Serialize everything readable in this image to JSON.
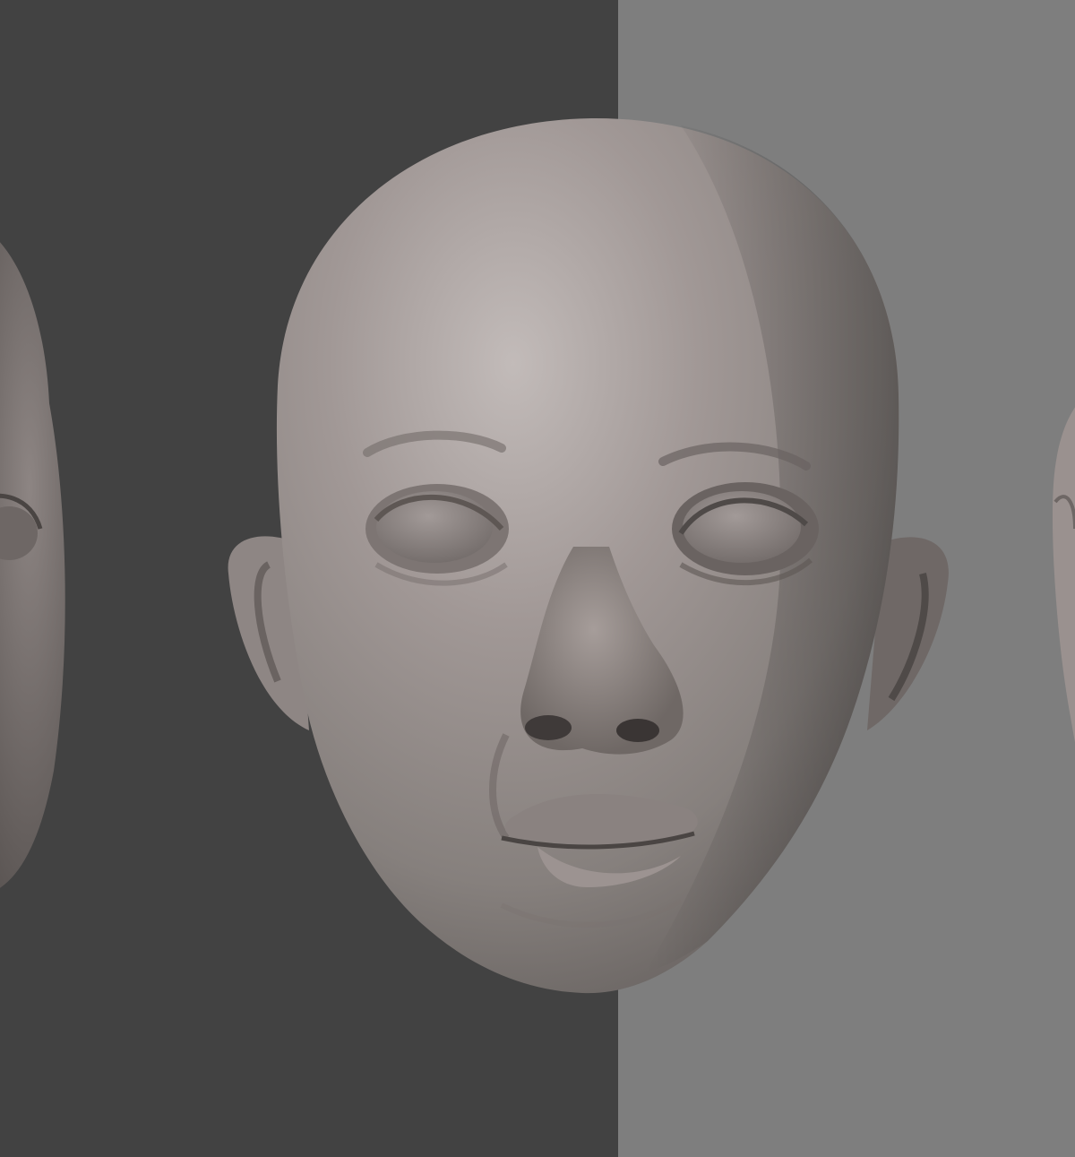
{
  "scene": {
    "subject": "sculpted-head-render",
    "colors": {
      "background_left": "#424242",
      "background_right": "#7e7e7e",
      "clay_light": "#bdb6b4",
      "clay_mid": "#8f8784",
      "clay_dark": "#5e5754",
      "clay_shadow": "#3f3a39"
    }
  }
}
